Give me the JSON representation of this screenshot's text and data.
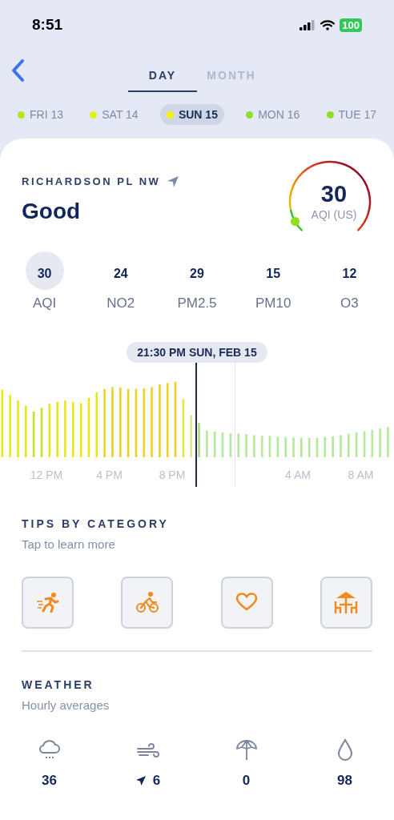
{
  "status_bar": {
    "time": "8:51",
    "battery": "100"
  },
  "tabs": [
    {
      "label": "DAY",
      "selected": true
    },
    {
      "label": "MONTH",
      "selected": false
    }
  ],
  "days": [
    {
      "label": "FRI 13",
      "color": "#b5e61d",
      "selected": false
    },
    {
      "label": "SAT 14",
      "color": "#e0f01a",
      "selected": false
    },
    {
      "label": "SUN 15",
      "color": "#f5f200",
      "selected": true
    },
    {
      "label": "MON 16",
      "color": "#8fdc2a",
      "selected": false
    },
    {
      "label": "TUE 17",
      "color": "#8fdc2a",
      "selected": false
    }
  ],
  "location": "RICHARDSON PL NW",
  "rating": "Good",
  "gauge": {
    "value": "30",
    "unit": "AQI (US)"
  },
  "pollutants": [
    {
      "value": "30",
      "label": "AQI",
      "selected": true
    },
    {
      "value": "24",
      "label": "NO2",
      "selected": false
    },
    {
      "value": "29",
      "label": "PM2.5",
      "selected": false
    },
    {
      "value": "15",
      "label": "PM10",
      "selected": false
    },
    {
      "value": "12",
      "label": "O3",
      "selected": false
    }
  ],
  "timeline": {
    "tooltip": "21:30 PM SUN, FEB 15",
    "axis_labels": [
      "12 PM",
      "4 PM",
      "8 PM",
      "4 AM",
      "8 AM"
    ]
  },
  "tips": {
    "title": "TIPS BY CATEGORY",
    "subtitle": "Tap to learn more",
    "categories": [
      {
        "kind": "running"
      },
      {
        "kind": "cycling"
      },
      {
        "kind": "health"
      },
      {
        "kind": "outdoor"
      }
    ]
  },
  "weather": {
    "title": "WEATHER",
    "subtitle": "Hourly averages",
    "items": [
      {
        "kind": "rain",
        "value": "36"
      },
      {
        "kind": "wind",
        "value": "6"
      },
      {
        "kind": "umbrella",
        "value": "0"
      },
      {
        "kind": "humidity",
        "value": "98"
      }
    ]
  }
}
